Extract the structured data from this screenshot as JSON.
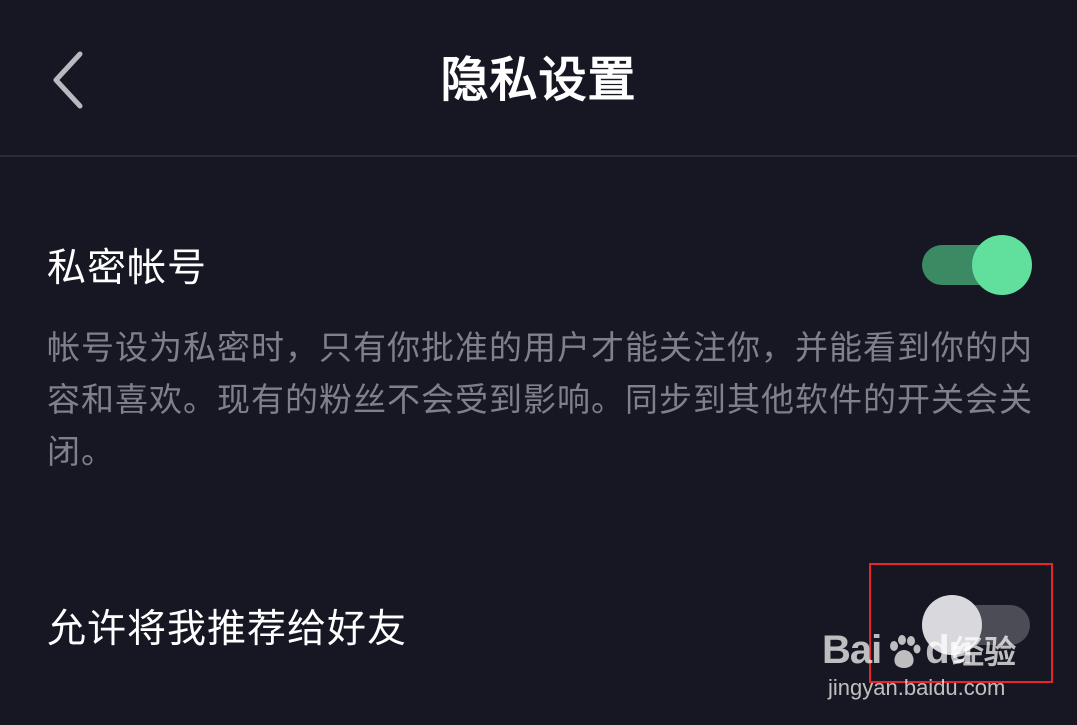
{
  "header": {
    "title": "隐私设置",
    "back_icon": "chevron-left-icon"
  },
  "settings": {
    "private_account": {
      "label": "私密帐号",
      "description": "帐号设为私密时，只有你批准的用户才能关注你，并能看到你的内容和喜欢。现有的粉丝不会受到影响。同步到其他软件的开关会关闭。",
      "enabled": true
    },
    "recommend_to_friends": {
      "label": "允许将我推荐给好友",
      "enabled": false
    }
  },
  "watermark": {
    "brand": "Bai",
    "brand_suffix": "du",
    "product": "经验",
    "url": "jingyan.baidu.com"
  },
  "colors": {
    "background": "#161722",
    "toggle_on_track": "#3b8a63",
    "toggle_on_knob": "#60df9d",
    "toggle_off_track": "#4b4c55",
    "toggle_off_knob": "#d9d9dd",
    "highlight": "#e5242b"
  }
}
